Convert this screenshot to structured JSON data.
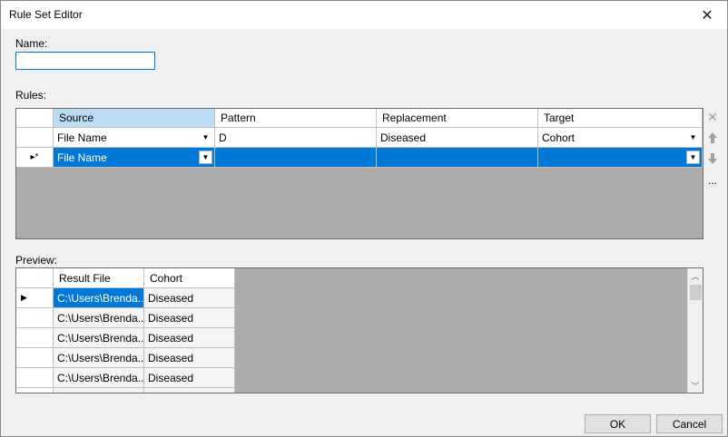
{
  "window": {
    "title": "Rule Set Editor"
  },
  "name_field": {
    "label": "Name:",
    "value": ""
  },
  "rules": {
    "label": "Rules:",
    "columns": [
      "Source",
      "Pattern",
      "Replacement",
      "Target"
    ],
    "rows": [
      {
        "marker": "",
        "source": "File Name",
        "pattern": "D",
        "replacement": "Diseased",
        "target": "Cohort"
      },
      {
        "marker": "▸*",
        "source": "File Name",
        "pattern": "",
        "replacement": "",
        "target": ""
      }
    ],
    "ellipsis": "..."
  },
  "preview": {
    "label": "Preview:",
    "columns": [
      "Result File",
      "Cohort"
    ],
    "rows": [
      {
        "marker": "▶",
        "result_file": "C:\\Users\\Brenda...",
        "cohort": "Diseased"
      },
      {
        "marker": "",
        "result_file": "C:\\Users\\Brenda...",
        "cohort": "Diseased"
      },
      {
        "marker": "",
        "result_file": "C:\\Users\\Brenda...",
        "cohort": "Diseased"
      },
      {
        "marker": "",
        "result_file": "C:\\Users\\Brenda...",
        "cohort": "Diseased"
      },
      {
        "marker": "",
        "result_file": "C:\\Users\\Brenda...",
        "cohort": "Diseased"
      }
    ]
  },
  "buttons": {
    "ok": "OK",
    "cancel": "Cancel"
  },
  "icons": {
    "close": "close-icon",
    "delete": "delete-x-icon",
    "move_up": "arrow-up-icon",
    "move_down": "arrow-down-icon",
    "combo": "chevron-down-icon"
  },
  "colors": {
    "selection": "#0078d7",
    "header_selected": "#bcdcf4",
    "grid_background": "#ababab"
  }
}
